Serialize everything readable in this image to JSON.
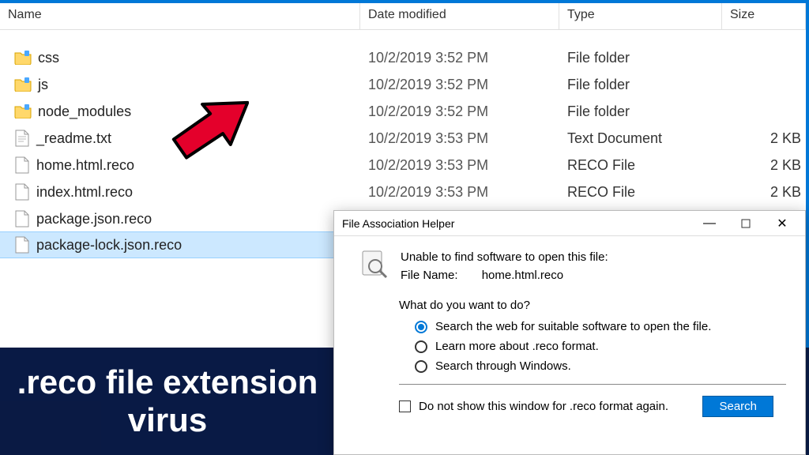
{
  "columns": {
    "name": "Name",
    "date": "Date modified",
    "type": "Type",
    "size": "Size"
  },
  "rows": [
    {
      "icon": "folder",
      "name": "css",
      "date": "10/2/2019 3:52 PM",
      "type": "File folder",
      "size": ""
    },
    {
      "icon": "folder",
      "name": "js",
      "date": "10/2/2019 3:52 PM",
      "type": "File folder",
      "size": ""
    },
    {
      "icon": "folder",
      "name": "node_modules",
      "date": "10/2/2019 3:52 PM",
      "type": "File folder",
      "size": ""
    },
    {
      "icon": "text",
      "name": "_readme.txt",
      "date": "10/2/2019 3:53 PM",
      "type": "Text Document",
      "size": "2 KB"
    },
    {
      "icon": "blank",
      "name": "home.html.reco",
      "date": "10/2/2019 3:53 PM",
      "type": "RECO File",
      "size": "2 KB"
    },
    {
      "icon": "blank",
      "name": "index.html.reco",
      "date": "10/2/2019 3:53 PM",
      "type": "RECO File",
      "size": "2 KB"
    },
    {
      "icon": "blank",
      "name": "package.json.reco",
      "date": "",
      "type": "",
      "size": ""
    },
    {
      "icon": "blank",
      "name": "package-lock.json.reco",
      "date": "",
      "type": "",
      "size": "",
      "selected": true
    }
  ],
  "dialog": {
    "title": "File Association Helper",
    "unable": "Unable to find software to open this file:",
    "filename_label": "File Name:",
    "filename": "home.html.reco",
    "prompt": "What do you want to do?",
    "options": [
      "Search the web for suitable software to open the file.",
      "Learn more about .reco format.",
      "Search through Windows."
    ],
    "dont_show": "Do not show this window for .reco format again.",
    "search_btn": "Search"
  },
  "caption": ".reco file extension virus"
}
